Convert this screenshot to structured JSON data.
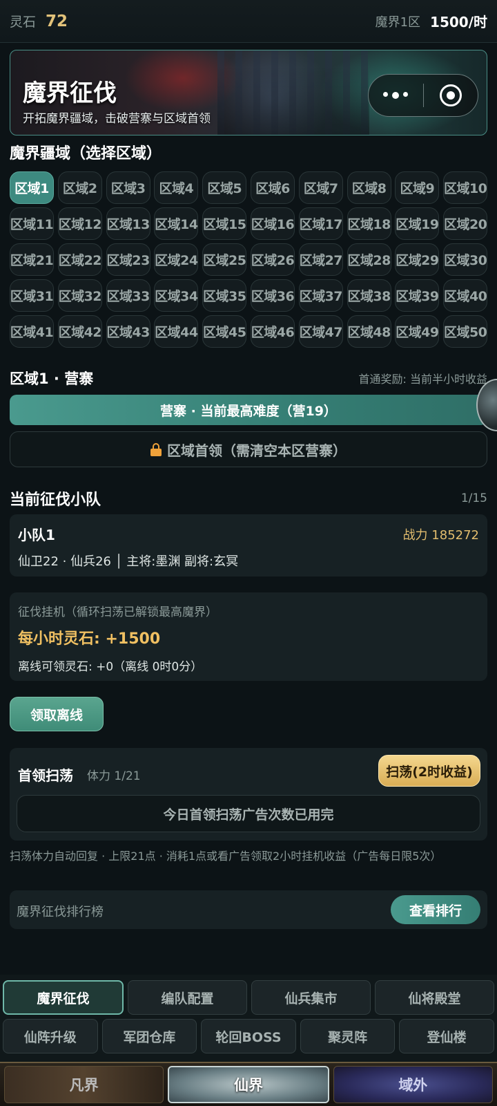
{
  "status": {
    "stone_label": "灵石",
    "stone_value": "72",
    "server": "魔界1区",
    "rate": "1500/时"
  },
  "banner": {
    "title": "魔界征伐",
    "subtitle": "开拓魔界疆域，击破营寨与区域首领"
  },
  "regions": {
    "title": "魔界疆域（选择区域）",
    "items": [
      "区域1",
      "区域2",
      "区域3",
      "区域4",
      "区域5",
      "区域6",
      "区域7",
      "区域8",
      "区域9",
      "区域10",
      "区域11",
      "区域12",
      "区域13",
      "区域14",
      "区域15",
      "区域16",
      "区域17",
      "区域18",
      "区域19",
      "区域20",
      "区域21",
      "区域22",
      "区域23",
      "区域24",
      "区域25",
      "区域26",
      "区域27",
      "区域28",
      "区域29",
      "区域30",
      "区域31",
      "区域32",
      "区域33",
      "区域34",
      "区域35",
      "区域36",
      "区域37",
      "区域38",
      "区域39",
      "区域40",
      "区域41",
      "区域42",
      "区域43",
      "区域44",
      "区域45",
      "区域46",
      "区域47",
      "区域48",
      "区域49",
      "区域50"
    ],
    "selected": "区域1"
  },
  "camp": {
    "title": "区域1 · 营寨",
    "reward_note": "首通奖励: 当前半小时收益",
    "camp_button": "营寨 · 当前最高难度（营19）",
    "boss_button": "区域首领（需清空本区营寨）"
  },
  "squad": {
    "title": "当前征伐小队",
    "count": "1/15",
    "name": "小队1",
    "power": "战力 185272",
    "detail": "仙卫22 · 仙兵26 │ 主将:墨渊 副将:玄冥"
  },
  "afk": {
    "title": "征伐挂机（循环扫荡已解锁最高魔界）",
    "hourly": "每小时灵石: +1500",
    "offline": "离线可领灵石: +0（离线 0时0分）",
    "claim_button": "领取离线"
  },
  "boss_sweep": {
    "title": "首领扫荡",
    "stamina": "体力 1/21",
    "sweep_button": "扫荡(2时收益)",
    "used_notice": "今日首领扫荡广告次数已用完",
    "note": "扫荡体力自动回复 · 上限21点 · 消耗1点或看广告领取2小时挂机收益（广告每日限5次）"
  },
  "ranking": {
    "label": "魔界征伐排行榜",
    "button": "查看排行"
  },
  "func_tabs": {
    "row1": [
      "魔界征伐",
      "编队配置",
      "仙兵集市",
      "仙将殿堂"
    ],
    "row2": [
      "仙阵升级",
      "军团仓库",
      "轮回BOSS",
      "聚灵阵",
      "登仙楼"
    ],
    "active": "魔界征伐"
  },
  "world_tabs": [
    "凡界",
    "仙界",
    "域外"
  ],
  "world_active": "仙界",
  "colors": {
    "accent": "#3d8a80",
    "gold": "#e2c27a",
    "background": "#0c1316"
  },
  "icons": {
    "more": "more-dots-icon",
    "record": "target-icon",
    "lock": "lock-icon"
  }
}
